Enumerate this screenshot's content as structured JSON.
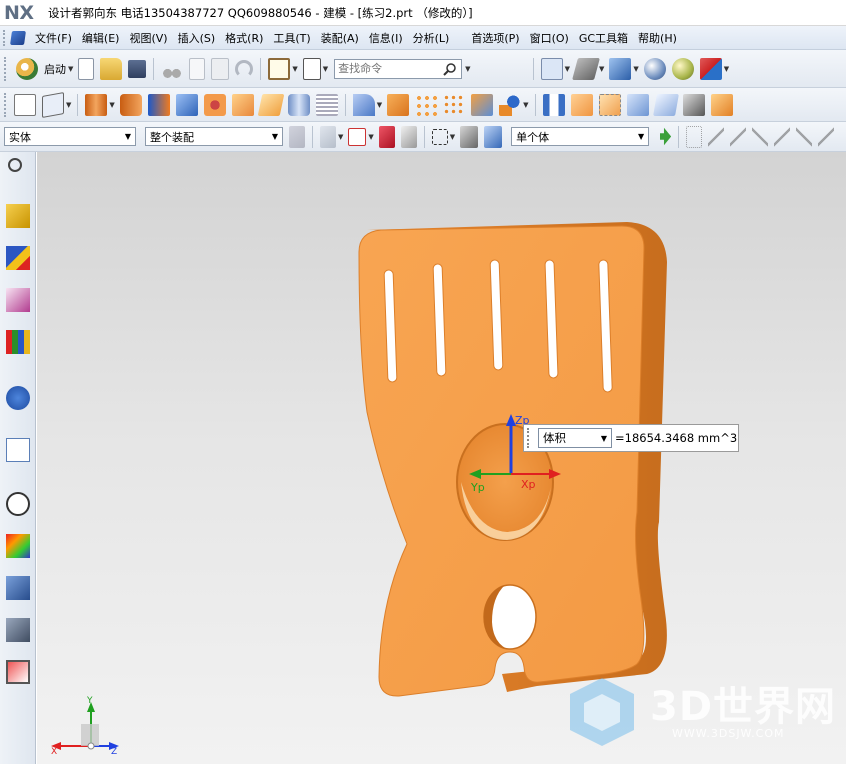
{
  "window": {
    "app_logo": "NX",
    "title": "设计者郭向东  电话13504387727  QQ609880546 - 建模 - [练习2.prt （修改的）]"
  },
  "menu": {
    "items": [
      {
        "label": "文件(F)"
      },
      {
        "label": "编辑(E)"
      },
      {
        "label": "视图(V)"
      },
      {
        "label": "插入(S)"
      },
      {
        "label": "格式(R)"
      },
      {
        "label": "工具(T)"
      },
      {
        "label": "装配(A)"
      },
      {
        "label": "信息(I)"
      },
      {
        "label": "分析(L)"
      },
      {
        "label": "首选项(P)"
      },
      {
        "label": "窗口(O)"
      },
      {
        "label": "GC工具箱"
      },
      {
        "label": "帮助(H)"
      }
    ]
  },
  "toolbar1": {
    "start_label": "启动",
    "search_placeholder": "查找命令"
  },
  "selection_bar": {
    "type_filter": "实体",
    "scope_filter": "整个装配",
    "body_filter": "单个体"
  },
  "measure": {
    "option": "体积",
    "value": "=18654.3468 mm^3"
  },
  "triad": {
    "x": "Xp",
    "y": "Yp",
    "z": "Zp"
  },
  "view_triad": {
    "x": "X",
    "y": "Y",
    "z": "Z"
  },
  "watermark": {
    "text": "3D世界网",
    "url": "WWW.3DSJW.COM"
  },
  "colors": {
    "part": "#f59c45",
    "part_shade": "#d9792a",
    "axis_x": "#e02020",
    "axis_y": "#20a020",
    "axis_z": "#2040e0"
  }
}
